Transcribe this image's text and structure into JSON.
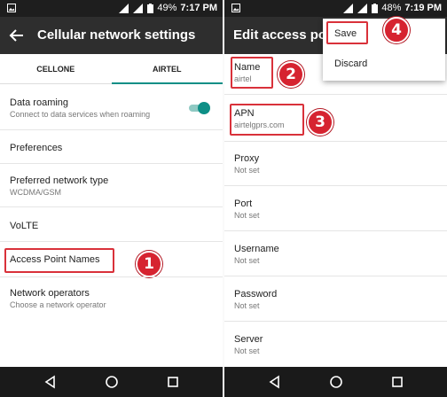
{
  "left": {
    "status": {
      "battery": "49%",
      "time": "7:17 PM"
    },
    "appbar": {
      "title": "Cellular network settings"
    },
    "tabs": [
      "CELLONE",
      "AIRTEL"
    ],
    "items": [
      {
        "title": "Data roaming",
        "subtitle": "Connect to data services when roaming"
      },
      {
        "title": "Preferences",
        "subtitle": ""
      },
      {
        "title": "Preferred network type",
        "subtitle": "WCDMA/GSM"
      },
      {
        "title": "VoLTE",
        "subtitle": ""
      },
      {
        "title": "Access Point Names",
        "subtitle": ""
      },
      {
        "title": "Network operators",
        "subtitle": "Choose a network operator"
      }
    ],
    "data_roaming_enabled": true,
    "badge": "1"
  },
  "right": {
    "status": {
      "battery": "48%",
      "time": "7:19 PM"
    },
    "appbar": {
      "title": "Edit access poin"
    },
    "fields": [
      {
        "label": "Name",
        "value": "airtel"
      },
      {
        "label": "APN",
        "value": "airtelgprs.com"
      },
      {
        "label": "Proxy",
        "value": "Not set"
      },
      {
        "label": "Port",
        "value": "Not set"
      },
      {
        "label": "Username",
        "value": "Not set"
      },
      {
        "label": "Password",
        "value": "Not set"
      },
      {
        "label": "Server",
        "value": "Not set"
      }
    ],
    "menu": {
      "save": "Save",
      "discard": "Discard"
    },
    "badges": [
      "2",
      "3",
      "4"
    ]
  },
  "colors": {
    "accent": "#0e8f86",
    "highlight": "#d9313a",
    "badge": "#d62330",
    "appbar": "#2e2e2e",
    "statusbar": "#1e1e1e"
  },
  "icons": [
    "back-arrow-icon",
    "signal-icon",
    "battery-icon",
    "nav-back-icon",
    "nav-home-icon",
    "nav-recents-icon"
  ]
}
